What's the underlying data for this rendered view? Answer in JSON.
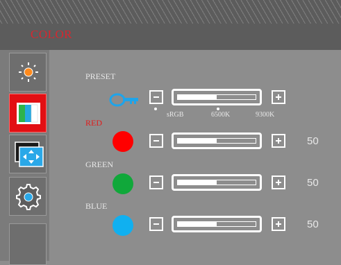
{
  "header": {
    "title": "COLOR"
  },
  "sidebar": {
    "items": [
      {
        "icon": "brightness-icon",
        "active": false
      },
      {
        "icon": "color-bars-icon",
        "active": true
      },
      {
        "icon": "image-position-icon",
        "active": false
      },
      {
        "icon": "settings-gear-icon",
        "active": false
      },
      {
        "icon": "empty",
        "active": false
      }
    ]
  },
  "preset": {
    "label": "PRESET",
    "icon": "key-icon",
    "options": [
      "sRGB",
      "6500K",
      "9300K"
    ],
    "level": 0.5
  },
  "red": {
    "label": "RED",
    "value": "50",
    "color": "#ff0000",
    "level": 0.5
  },
  "green": {
    "label": "GREEN",
    "value": "50",
    "color": "#10a83a",
    "level": 0.5
  },
  "blue": {
    "label": "BLUE",
    "value": "50",
    "color": "#10b0f0",
    "level": 0.5
  },
  "colors": {
    "accent": "#e20f13",
    "title": "#d8262f"
  }
}
